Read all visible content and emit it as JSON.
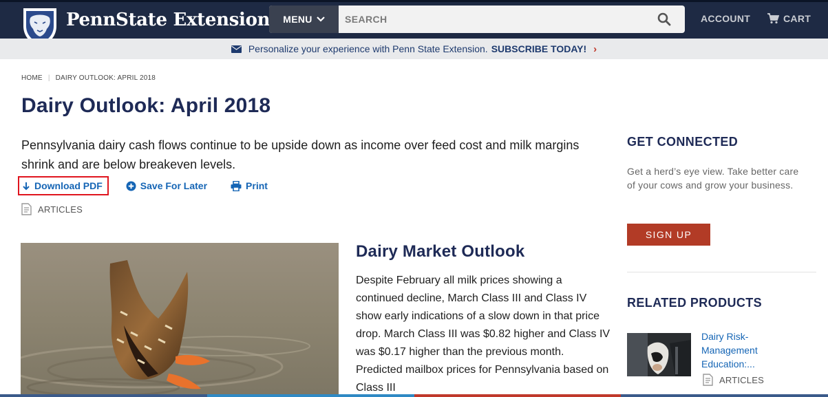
{
  "header": {
    "brand": "PennState Extension",
    "menu_label": "MENU",
    "search_placeholder": "SEARCH",
    "account_label": "ACCOUNT",
    "cart_label": "CART"
  },
  "promo": {
    "text": "Personalize your experience with Penn State Extension.",
    "link": "SUBSCRIBE TODAY!"
  },
  "breadcrumb": [
    "HOME",
    "DAIRY OUTLOOK: APRIL 2018"
  ],
  "article": {
    "title": "Dairy Outlook: April 2018",
    "intro": "Pennsylvania dairy cash flows continue to be upside down as income over feed cost and milk margins shrink and are below breakeven levels.",
    "actions": {
      "download": "Download PDF",
      "save": "Save For Later",
      "print": "Print"
    },
    "category": "ARTICLES",
    "section_title": "Dairy Market Outlook",
    "section_body": "Despite February all milk prices showing a continued decline, March Class III and Class IV show early indications of a slow down in that price drop. March Class III was $0.82 higher and Class IV was $0.17 higher than the previous month. Predicted mailbox prices for Pennsylvania based on Class III"
  },
  "sidebar": {
    "connect_heading": "GET CONNECTED",
    "connect_text": "Get a herd’s eye view. Take better care of your cows and grow your business.",
    "signup_label": "SIGN UP",
    "related_heading": "RELATED PRODUCTS",
    "product_title": "Dairy Risk-Management Education:...",
    "product_category": "ARTICLES"
  },
  "colors": {
    "header_bg": "#1e2a44",
    "title_navy": "#1e2a56",
    "link_blue": "#1565b5",
    "signup_red": "#b23b26",
    "highlight_red": "#e0141e"
  }
}
